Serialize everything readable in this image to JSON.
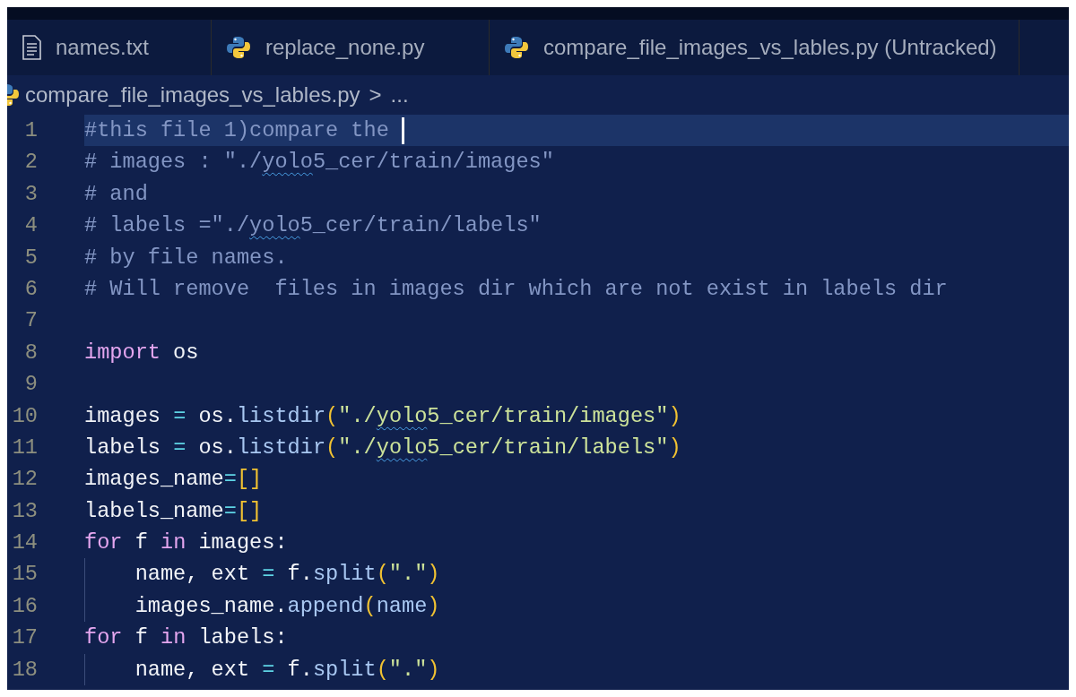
{
  "tabs": [
    {
      "label": "names.txt",
      "kind": "text"
    },
    {
      "label": "replace_none.py",
      "kind": "python"
    },
    {
      "label": "compare_file_images_vs_lables.py (Untracked)",
      "kind": "python"
    }
  ],
  "breadcrumb": {
    "kind": "python",
    "file": "compare_file_images_vs_lables.py",
    "separator": ">",
    "rest": "..."
  },
  "lines": [
    {
      "number": "1",
      "current": true,
      "cursor": true,
      "tokens": [
        {
          "kind": "comment",
          "text": "#this file 1)compare the "
        }
      ]
    },
    {
      "number": "2",
      "tokens": [
        {
          "kind": "comment",
          "text": "# images : \"./"
        },
        {
          "kind": "comment",
          "text": "yolo",
          "warning": true
        },
        {
          "kind": "comment",
          "text": "5_cer/train/images\""
        }
      ]
    },
    {
      "number": "3",
      "tokens": [
        {
          "kind": "comment",
          "text": "# and"
        }
      ]
    },
    {
      "number": "4",
      "tokens": [
        {
          "kind": "comment",
          "text": "# labels =\"./"
        },
        {
          "kind": "comment",
          "text": "yolo",
          "warning": true
        },
        {
          "kind": "comment",
          "text": "5_cer/train/labels\""
        }
      ]
    },
    {
      "number": "5",
      "tokens": [
        {
          "kind": "comment",
          "text": "# by file names."
        }
      ]
    },
    {
      "number": "6",
      "tokens": [
        {
          "kind": "comment",
          "text": "# Will remove  files in images dir which are not exist in labels dir"
        }
      ]
    },
    {
      "number": "7"
    },
    {
      "number": "8",
      "tokens": [
        {
          "kind": "keyword",
          "text": "import"
        },
        {
          "kind": "plain",
          "text": " os"
        }
      ]
    },
    {
      "number": "9"
    },
    {
      "number": "10",
      "tokens": [
        {
          "kind": "plain",
          "text": "images "
        },
        {
          "kind": "operator",
          "text": "="
        },
        {
          "kind": "plain",
          "text": " os."
        },
        {
          "kind": "function",
          "text": "listdir"
        },
        {
          "kind": "bracket",
          "text": "("
        },
        {
          "kind": "string",
          "text": "\"./"
        },
        {
          "kind": "string",
          "text": "yolo",
          "warning": true
        },
        {
          "kind": "string",
          "text": "5_cer/train/images\""
        },
        {
          "kind": "bracket",
          "text": ")"
        }
      ]
    },
    {
      "number": "11",
      "tokens": [
        {
          "kind": "plain",
          "text": "labels "
        },
        {
          "kind": "operator",
          "text": "="
        },
        {
          "kind": "plain",
          "text": " os."
        },
        {
          "kind": "function",
          "text": "listdir"
        },
        {
          "kind": "bracket",
          "text": "("
        },
        {
          "kind": "string",
          "text": "\"./"
        },
        {
          "kind": "string",
          "text": "yolo",
          "warning": true
        },
        {
          "kind": "string",
          "text": "5_cer/train/labels\""
        },
        {
          "kind": "bracket",
          "text": ")"
        }
      ]
    },
    {
      "number": "12",
      "tokens": [
        {
          "kind": "plain",
          "text": "images_name"
        },
        {
          "kind": "operator",
          "text": "="
        },
        {
          "kind": "bracket",
          "text": "[]"
        }
      ]
    },
    {
      "number": "13",
      "tokens": [
        {
          "kind": "plain",
          "text": "labels_name"
        },
        {
          "kind": "operator",
          "text": "="
        },
        {
          "kind": "bracket",
          "text": "[]"
        }
      ]
    },
    {
      "number": "14",
      "tokens": [
        {
          "kind": "keyword",
          "text": "for"
        },
        {
          "kind": "plain",
          "text": " f "
        },
        {
          "kind": "keyword",
          "text": "in"
        },
        {
          "kind": "plain",
          "text": " images:"
        }
      ],
      "children": [
        {
          "number": "15",
          "tokens": [
            {
              "kind": "plain",
              "text": "name, ext "
            },
            {
              "kind": "operator",
              "text": "="
            },
            {
              "kind": "plain",
              "text": " f."
            },
            {
              "kind": "function",
              "text": "split"
            },
            {
              "kind": "bracket",
              "text": "("
            },
            {
              "kind": "string",
              "text": "\".\""
            },
            {
              "kind": "bracket",
              "text": ")"
            }
          ]
        },
        {
          "number": "16",
          "tokens": [
            {
              "kind": "plain",
              "text": "images_name."
            },
            {
              "kind": "function",
              "text": "append"
            },
            {
              "kind": "bracket",
              "text": "("
            },
            {
              "kind": "function",
              "text": "name"
            },
            {
              "kind": "bracket",
              "text": ")"
            }
          ]
        }
      ]
    },
    {
      "number": "17",
      "tokens": [
        {
          "kind": "keyword",
          "text": "for"
        },
        {
          "kind": "plain",
          "text": " f "
        },
        {
          "kind": "keyword",
          "text": "in"
        },
        {
          "kind": "plain",
          "text": " labels:"
        }
      ],
      "children": [
        {
          "number": "18",
          "tokens": [
            {
              "kind": "plain",
              "text": "name, ext "
            },
            {
              "kind": "operator",
              "text": "="
            },
            {
              "kind": "plain",
              "text": " f."
            },
            {
              "kind": "function",
              "text": "split"
            },
            {
              "kind": "bracket",
              "text": "("
            },
            {
              "kind": "string",
              "text": "\".\""
            },
            {
              "kind": "bracket",
              "text": ")"
            }
          ]
        }
      ]
    }
  ]
}
